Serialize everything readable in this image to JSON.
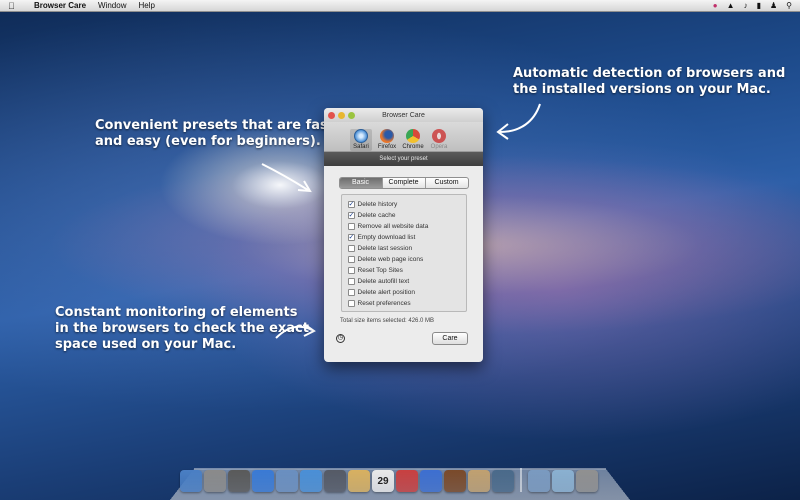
{
  "menubar": {
    "app_name": "Browser Care",
    "menus": [
      "Window",
      "Help"
    ]
  },
  "callouts": {
    "top_left": [
      "Convenient presets that are fast",
      "and easy (even for beginners)."
    ],
    "top_right": [
      "Automatic detection of browsers and",
      "the installed versions on your Mac."
    ],
    "bottom_left": [
      "Constant monitoring of elements",
      "in the browsers to check the exact",
      "space used on your Mac."
    ]
  },
  "window": {
    "title": "Browser Care",
    "browsers": [
      {
        "name": "Safari",
        "color": "#4a8fd6"
      },
      {
        "name": "Firefox",
        "color": "#e8762b"
      },
      {
        "name": "Chrome",
        "color": "#3aa655"
      },
      {
        "name": "Opera",
        "color": "#cc2a2a"
      }
    ],
    "preset_label": "Select your preset",
    "tabs": [
      "Basic",
      "Complete",
      "Custom"
    ],
    "options": [
      {
        "label": "Delete history",
        "checked": true
      },
      {
        "label": "Delete cache",
        "checked": true
      },
      {
        "label": "Remove all website data",
        "checked": false
      },
      {
        "label": "Empty download list",
        "checked": true
      },
      {
        "label": "Delete last session",
        "checked": false
      },
      {
        "label": "Delete web page icons",
        "checked": false
      },
      {
        "label": "Reset Top Sites",
        "checked": false
      },
      {
        "label": "Delete autofill text",
        "checked": false
      },
      {
        "label": "Delete alert position",
        "checked": false
      },
      {
        "label": "Reset preferences",
        "checked": false
      }
    ],
    "total_size": "Total size items selected: 426.0 MB",
    "care_button": "Care"
  },
  "dock": {
    "calendar_day": "29",
    "icon_colors": [
      "#4a7fc4",
      "#8a8a8a",
      "#5a5a5a",
      "#3a7ad4",
      "#6a8fc0",
      "#4a8fd6",
      "#555a66",
      "#d8b060",
      "#e9e9e9",
      "#c84040",
      "#3d6fd0",
      "#7a4a2a",
      "#c0a070",
      "#4a6a8a",
      "#7a9ac0",
      "#8ab0d0",
      "#909090"
    ]
  }
}
